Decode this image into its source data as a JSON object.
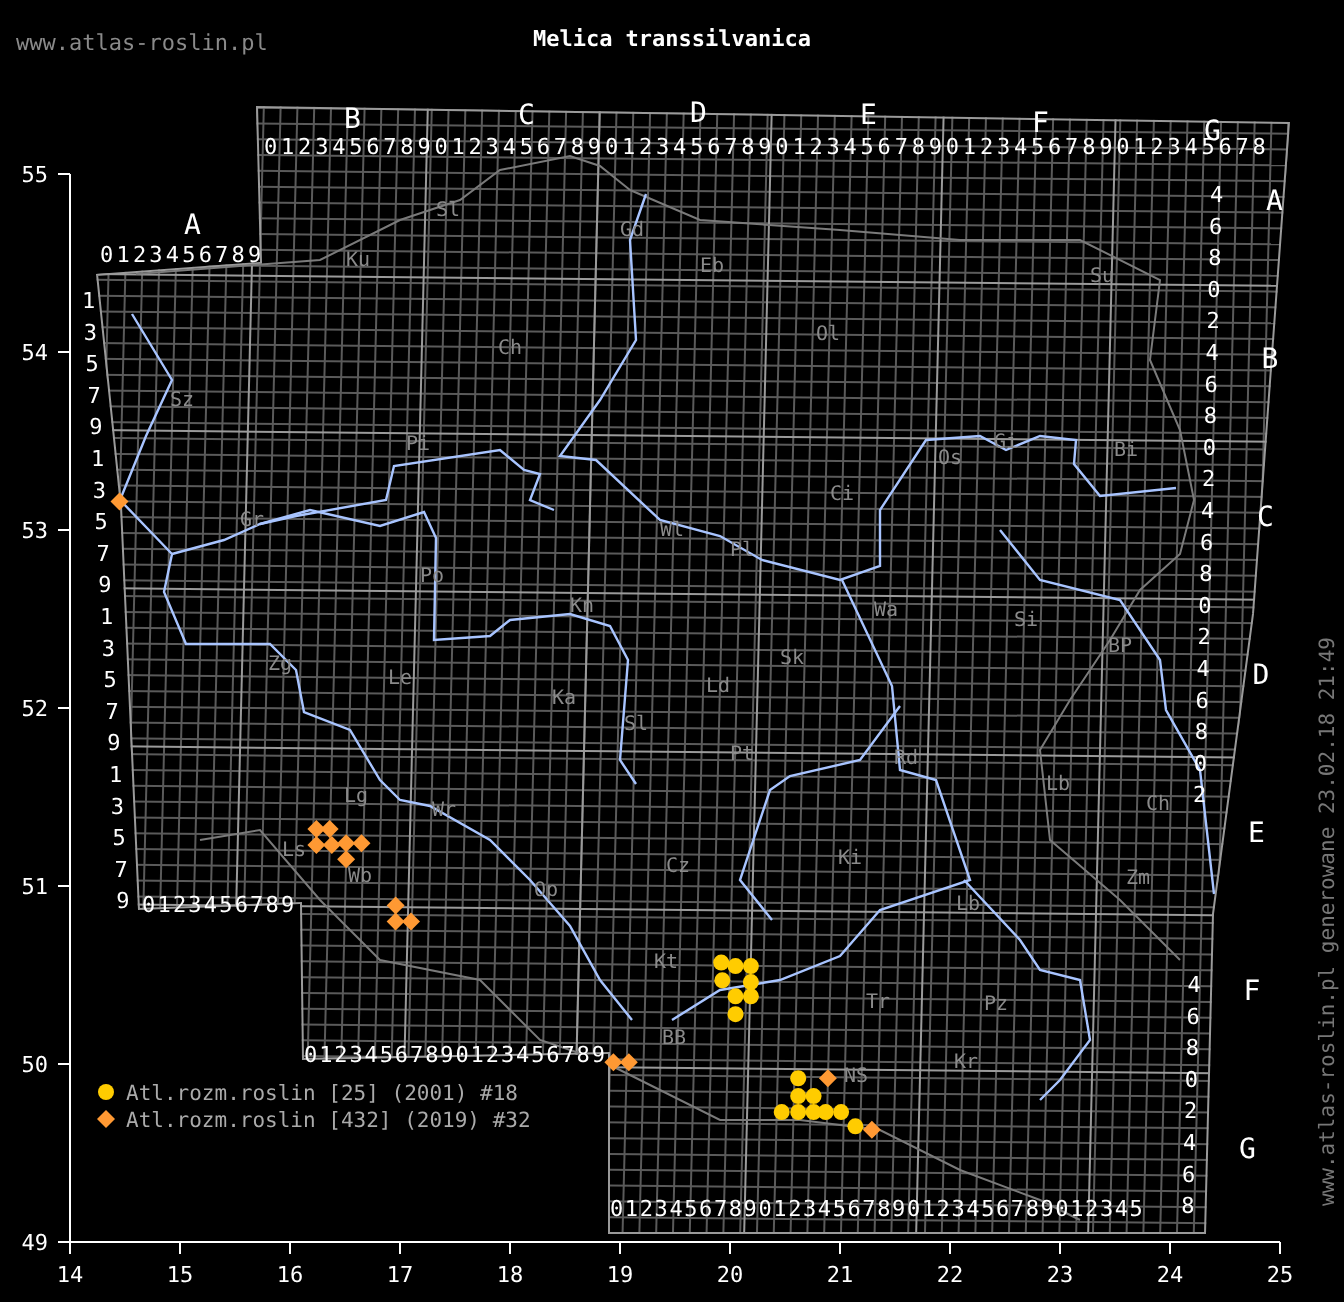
{
  "header": {
    "site": "www.atlas-roslin.pl",
    "title": "Melica transsilvanica"
  },
  "map": {
    "column_letters": [
      "A",
      "B",
      "C",
      "D",
      "E",
      "F",
      "G"
    ],
    "top_digits": [
      "0123456789",
      "01234567890123456789012345678901234567890123456789012345678"
    ],
    "bottom_digits": [
      "0123456789",
      "01234567890123456789",
      "012345678901234567890123456789012345"
    ],
    "left_digits": [
      "1",
      "3",
      "5",
      "7",
      "9",
      "1",
      "3",
      "5",
      "7",
      "9",
      "1",
      "3",
      "5",
      "7",
      "9",
      "1",
      "3",
      "5",
      "7",
      "9"
    ],
    "right_blocks": [
      {
        "letter": "A",
        "digits": [
          "4",
          "6",
          "8",
          "0",
          "2"
        ]
      },
      {
        "letter": "B",
        "digits": [
          "4",
          "6",
          "8",
          "0",
          "2"
        ]
      },
      {
        "letter": "C",
        "digits": [
          "4",
          "6",
          "8",
          "0",
          "2"
        ]
      },
      {
        "letter": "D",
        "digits": [
          "4",
          "6",
          "8",
          "0",
          "2"
        ]
      },
      {
        "letter": "E"
      },
      {
        "letter": "F",
        "digits": [
          "4",
          "6",
          "8",
          "0",
          "2"
        ]
      },
      {
        "letter": "G",
        "digits": [
          "4",
          "6",
          "8"
        ]
      }
    ],
    "regions": [
      "Sl",
      "Ku",
      "Gd",
      "Eb",
      "Su",
      "Ol",
      "Ch",
      "Sz",
      "Pi",
      "Os",
      "Gi",
      "Bi",
      "Ci",
      "Gr",
      "Wl",
      "Pl",
      "Po",
      "Wa",
      "Si",
      "Kn",
      "Zg",
      "Le",
      "BP",
      "Sk",
      "Ka",
      "Ld",
      "Sl",
      "Pt",
      "Rd",
      "Lb",
      "Lg",
      "Wr",
      "Ch",
      "Ls",
      "Wb",
      "Op",
      "Cz",
      "Ki",
      "Zm",
      "Kt",
      "Lb",
      "Tr",
      "Pz",
      "BB",
      "NS",
      "Kr"
    ],
    "chart_data": {
      "type": "scatter",
      "xlim": [
        14,
        25
      ],
      "ylim": [
        49,
        55
      ],
      "xticks": [
        14,
        15,
        16,
        17,
        18,
        19,
        20,
        21,
        22,
        23,
        24,
        25
      ],
      "yticks": [
        49,
        50,
        51,
        52,
        53,
        54,
        55
      ],
      "legend": "lower left",
      "series": [
        {
          "name": "Atl.rozm.roslin [25] (2001) #18",
          "color": "#ffcc00",
          "marker": "circle",
          "x": [
            19.92,
            20.05,
            19.93,
            20.19,
            20.05,
            20.19,
            20.05,
            20.19,
            20.62,
            20.62,
            20.76,
            20.47,
            20.62,
            20.76,
            20.87,
            21.01,
            21.14
          ],
          "values": [
            50.57,
            50.55,
            50.47,
            50.46,
            50.38,
            50.38,
            50.28,
            50.55,
            49.92,
            49.82,
            49.82,
            49.73,
            49.73,
            49.73,
            49.73,
            49.73,
            49.65
          ]
        },
        {
          "name": "Atl.rozm.roslin [432] (2019) #32",
          "color": "#ff9933",
          "marker": "diamond",
          "x": [
            16.24,
            16.36,
            16.24,
            16.38,
            16.51,
            16.65,
            16.51,
            16.96,
            16.96,
            17.1,
            18.94,
            19.08,
            14.45,
            21.29,
            20.89
          ],
          "values": [
            51.32,
            51.32,
            51.23,
            51.23,
            51.24,
            51.24,
            51.15,
            50.89,
            50.8,
            50.8,
            50.01,
            50.01,
            53.16,
            49.63,
            49.92
          ]
        }
      ]
    }
  },
  "footer": {
    "stamp": "www.atlas-roslin.pl generowane 23.02.18 21:49"
  }
}
